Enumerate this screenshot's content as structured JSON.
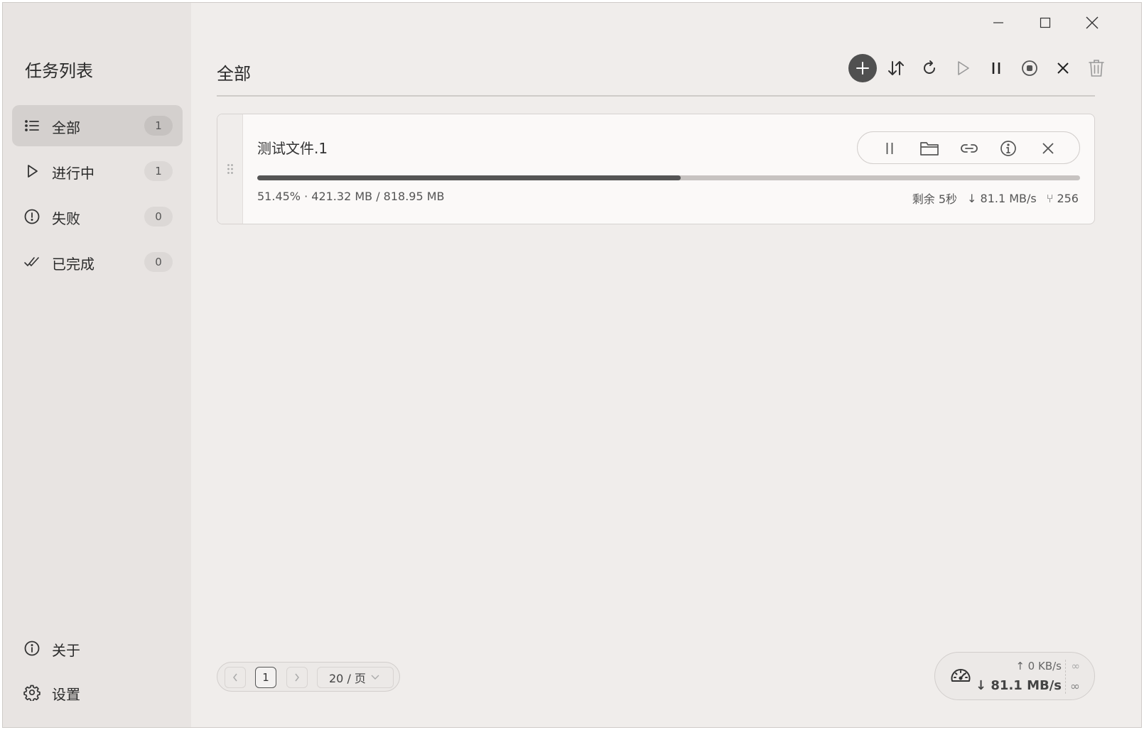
{
  "sidebar": {
    "title": "任务列表",
    "items": [
      {
        "label": "全部",
        "count": "1",
        "icon": "list-icon"
      },
      {
        "label": "进行中",
        "count": "1",
        "icon": "play-icon"
      },
      {
        "label": "失败",
        "count": "0",
        "icon": "alert-circle-icon"
      },
      {
        "label": "已完成",
        "count": "0",
        "icon": "double-check-icon"
      }
    ],
    "bottom": [
      {
        "label": "关于",
        "icon": "info-icon"
      },
      {
        "label": "设置",
        "icon": "gear-icon"
      }
    ]
  },
  "main": {
    "title": "全部",
    "toolbar": [
      "add-icon",
      "sort-icon",
      "refresh-icon",
      "play-icon",
      "pause-icon",
      "stop-icon",
      "close-icon",
      "trash-icon"
    ]
  },
  "task": {
    "name": "测试文件.1",
    "progress": 0.5145,
    "stats": "51.45% · 421.32 MB / 818.95 MB",
    "remaining": "剩余 5秒",
    "speed": "↓ 81.1 MB/s",
    "connections": "⑂ 256"
  },
  "pagination": {
    "current": "1",
    "page_size": "20 / 页"
  },
  "speed_widget": {
    "upload": "↑ 0 KB/s",
    "download": "↓ 81.1 MB/s",
    "upload_limit": "∞",
    "download_limit": "∞"
  },
  "colors": {
    "sidebar_bg": "#e8e4e2",
    "main_bg": "#f0edeb",
    "accent": "#505050",
    "progress": "#555555"
  }
}
